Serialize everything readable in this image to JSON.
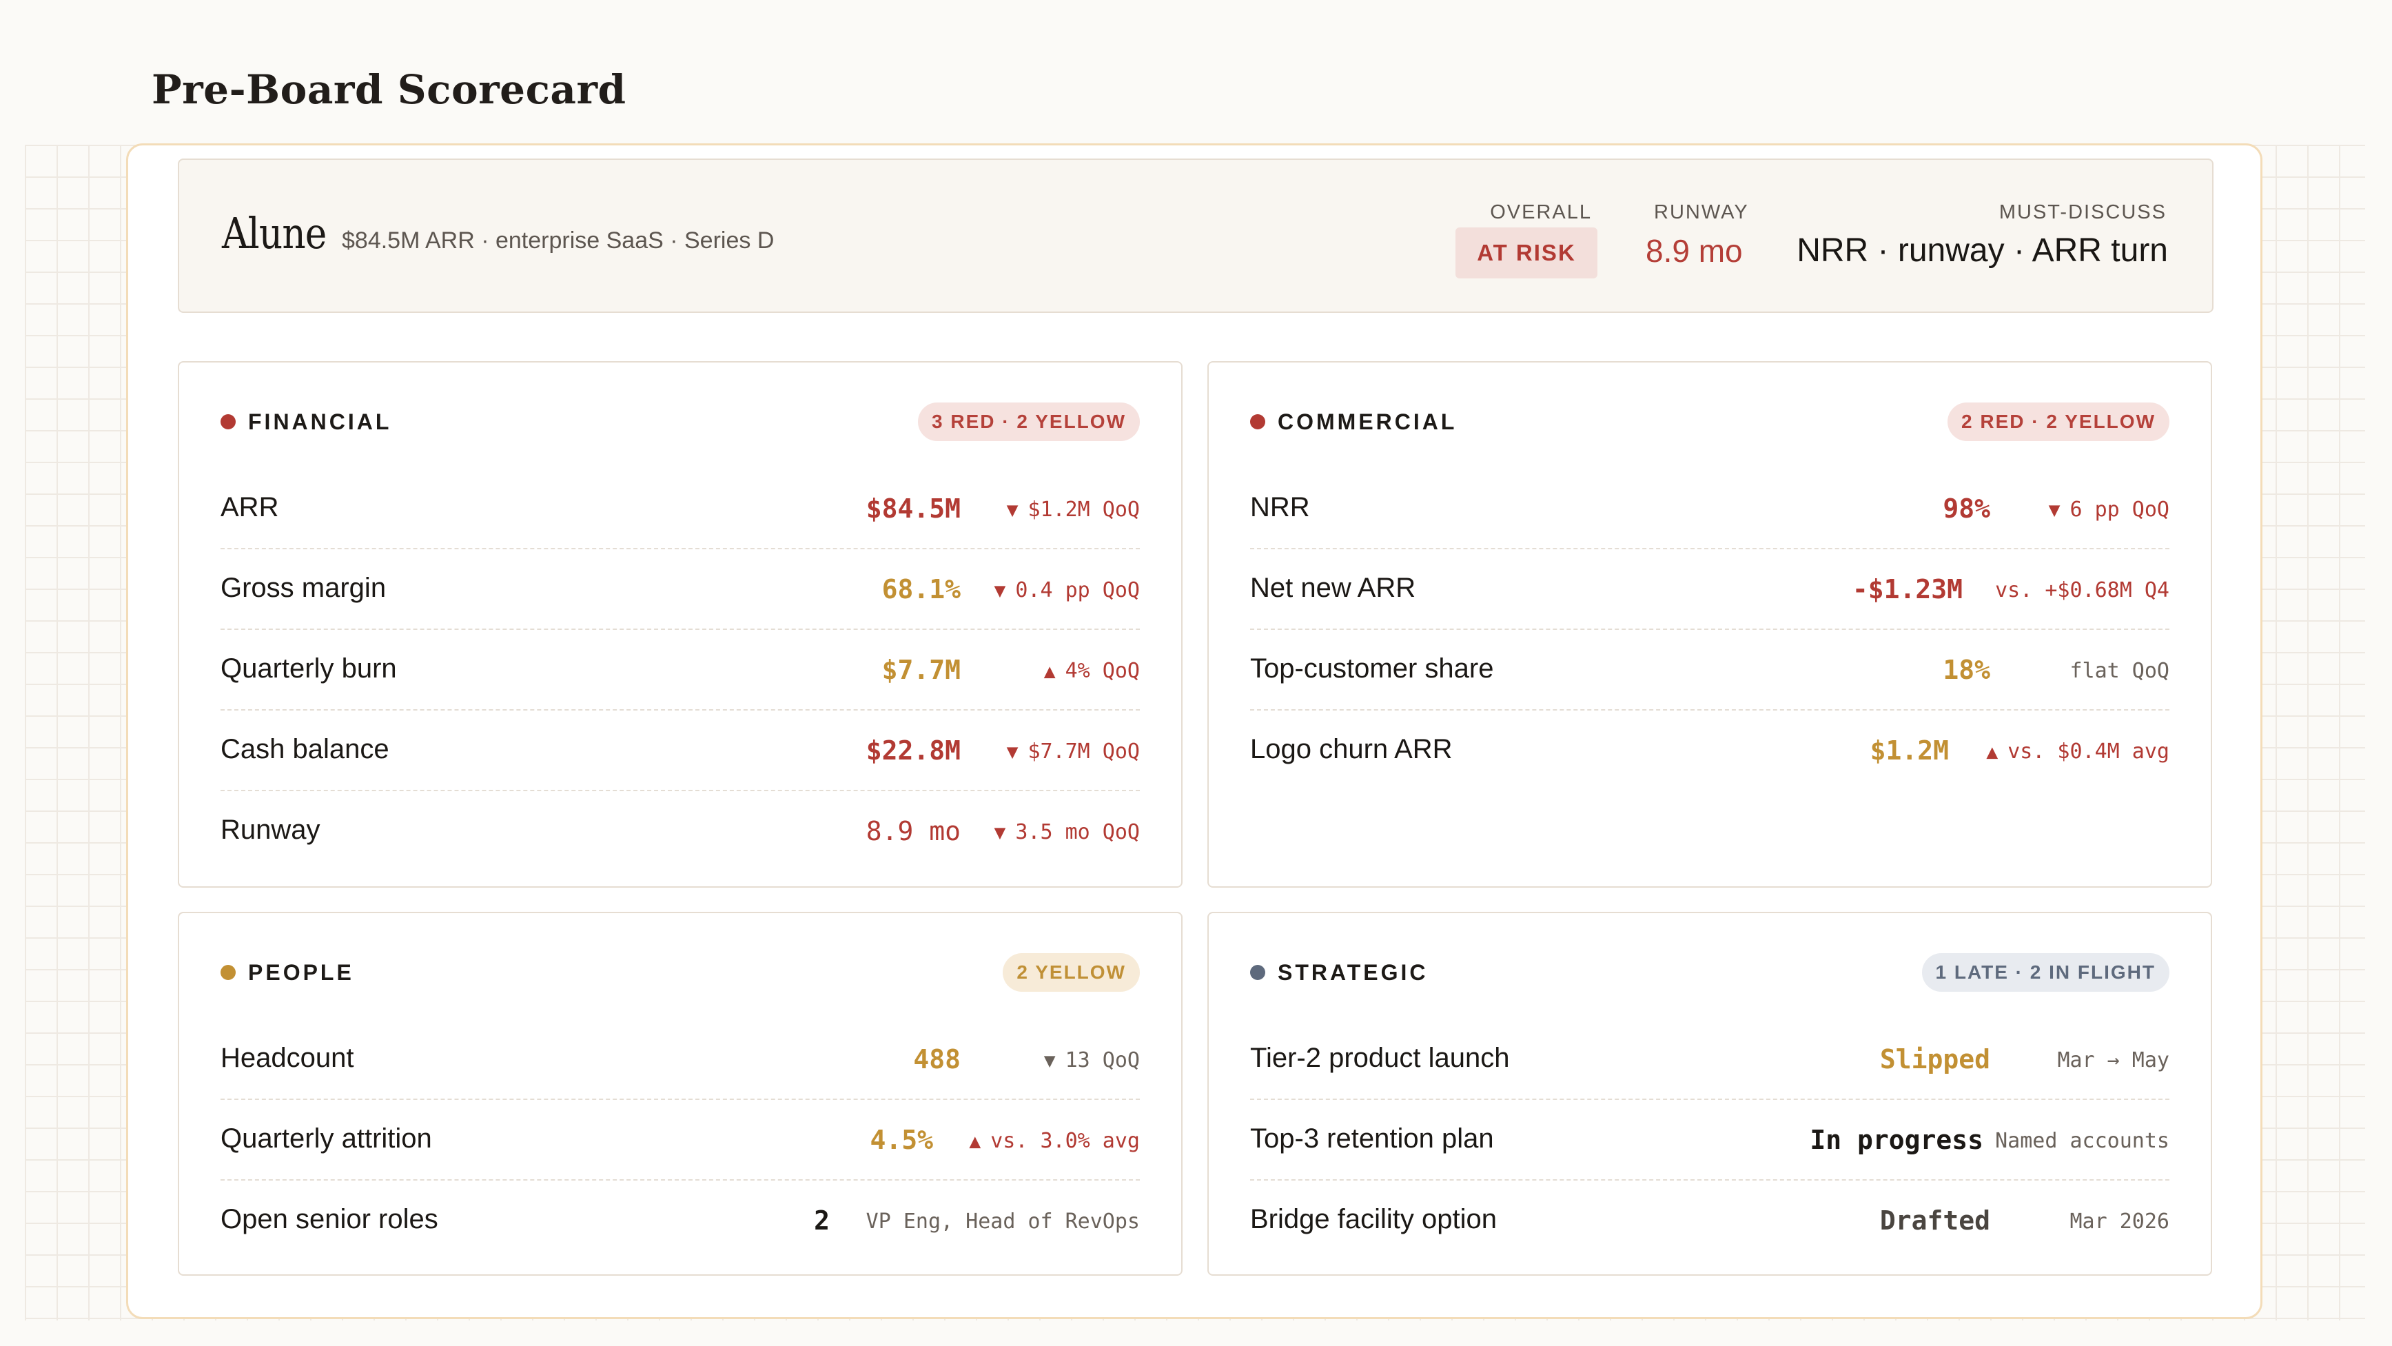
{
  "page_title": "Pre-Board Scorecard",
  "header": {
    "company": "Alune",
    "subline": "$84.5M ARR · enterprise SaaS · Series D",
    "overall_label": "OVERALL",
    "overall_status": "AT RISK",
    "runway_label": "RUNWAY",
    "runway_value": "8.9 mo",
    "must_label": "MUST-DISCUSS",
    "must_value": "NRR · runway · ARR turn"
  },
  "colors": {
    "red": "#b23a33",
    "yellow": "#c29033",
    "slate": "#5e6a7d",
    "frame_border": "#f3dcb8"
  },
  "cards": {
    "financial": {
      "title": "FINANCIAL",
      "badge": "3 RED · 2 YELLOW",
      "rows": [
        {
          "label": "ARR",
          "value": "$84.5M",
          "arrow": "▼",
          "delta": "$1.2M QoQ"
        },
        {
          "label": "Gross margin",
          "value": "68.1%",
          "arrow": "▼",
          "delta": "0.4 pp QoQ"
        },
        {
          "label": "Quarterly burn",
          "value": "$7.7M",
          "arrow": "▲",
          "delta": "4% QoQ"
        },
        {
          "label": "Cash balance",
          "value": "$22.8M",
          "arrow": "▼",
          "delta": "$7.7M QoQ"
        },
        {
          "label": "Runway",
          "value": "8.9 mo",
          "arrow": "▼",
          "delta": "3.5 mo QoQ"
        }
      ]
    },
    "commercial": {
      "title": "COMMERCIAL",
      "badge": "2 RED · 2 YELLOW",
      "rows": [
        {
          "label": "NRR",
          "value": "98%",
          "arrow": "▼",
          "delta": "6 pp QoQ"
        },
        {
          "label": "Net new ARR",
          "value": "-$1.23M",
          "delta": "vs. +$0.68M Q4"
        },
        {
          "label": "Top-customer share",
          "value": "18%",
          "delta": "flat QoQ"
        },
        {
          "label": "Logo churn ARR",
          "value": "$1.2M",
          "arrow": "▲",
          "delta": "vs. $0.4M avg"
        }
      ]
    },
    "people": {
      "title": "PEOPLE",
      "badge": "2 YELLOW",
      "rows": [
        {
          "label": "Headcount",
          "value": "488",
          "arrow": "▼",
          "delta": "13 QoQ"
        },
        {
          "label": "Quarterly attrition",
          "value": "4.5%",
          "arrow": "▲",
          "delta": "vs. 3.0% avg"
        },
        {
          "label": "Open senior roles",
          "value": "2",
          "delta": "VP Eng, Head of RevOps"
        }
      ]
    },
    "strategic": {
      "title": "STRATEGIC",
      "badge": "1 LATE · 2 IN FLIGHT",
      "rows": [
        {
          "label": "Tier-2 product launch",
          "value": "Slipped",
          "delta": "Mar → May"
        },
        {
          "label": "Top-3 retention plan",
          "value": "In progress",
          "delta": "Named accounts"
        },
        {
          "label": "Bridge facility option",
          "value": "Drafted",
          "delta": "Mar 2026"
        }
      ]
    }
  }
}
